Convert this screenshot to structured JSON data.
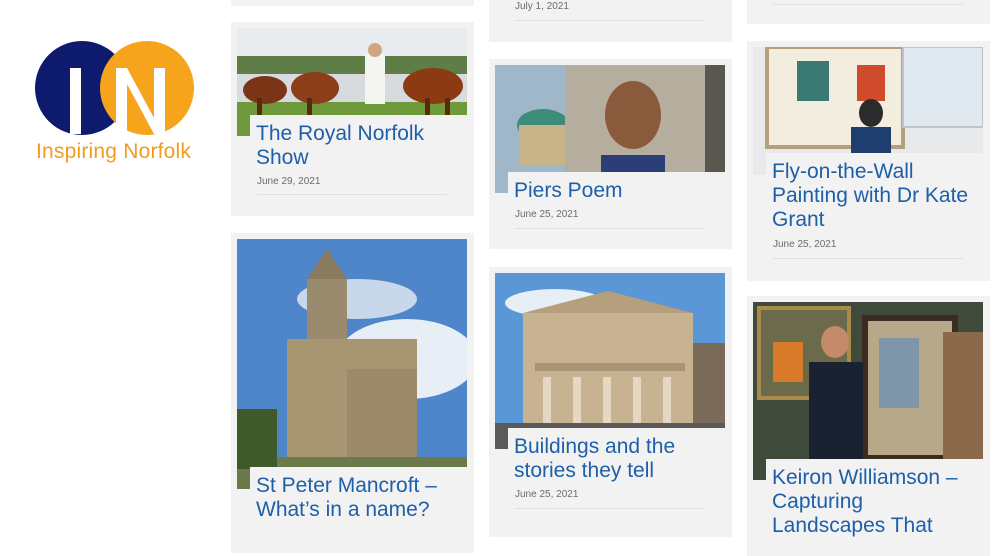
{
  "logo": {
    "text": "Inspiring Norfolk"
  },
  "posts": [
    {
      "title": "The Royal Norfolk Show",
      "date": "June 29, 2021"
    },
    {
      "title": "St Peter Mancroft – What’s in a name?",
      "date": ""
    },
    {
      "title": "",
      "date": "July 1, 2021"
    },
    {
      "title": "Piers Poem",
      "date": "June 25, 2021"
    },
    {
      "title": "Buildings and the stories they tell",
      "date": "June 25, 2021"
    },
    {
      "title": "Fly-on-the-Wall Painting with Dr Kate Grant",
      "date": "June 25, 2021"
    },
    {
      "title": "Keiron Williamson – Capturing Landscapes That",
      "date": ""
    }
  ]
}
